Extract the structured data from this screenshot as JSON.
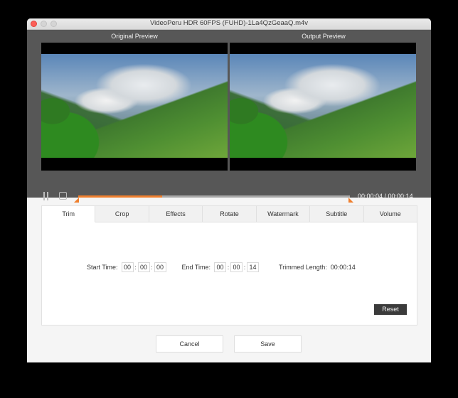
{
  "window": {
    "title": "VideoPeru  HDR 60FPS (FUHD)-1La4QzGeaaQ.m4v"
  },
  "preview": {
    "original_label": "Original Preview",
    "output_label": "Output  Preview"
  },
  "playback": {
    "progress_fraction": 0.31,
    "trim_start_fraction": 0.0,
    "trim_end_fraction": 1.0,
    "time_readout": "00:00:04 / 00:00:14",
    "accent_color": "#ef7f2e"
  },
  "tabs": [
    {
      "label": "Trim",
      "active": true
    },
    {
      "label": "Crop",
      "active": false
    },
    {
      "label": "Effects",
      "active": false
    },
    {
      "label": "Rotate",
      "active": false
    },
    {
      "label": "Watermark",
      "active": false
    },
    {
      "label": "Subtitle",
      "active": false
    },
    {
      "label": "Volume",
      "active": false
    }
  ],
  "trim": {
    "start_label": "Start Time:",
    "start": {
      "h": "00",
      "m": "00",
      "s": "00"
    },
    "end_label": "End Time:",
    "end": {
      "h": "00",
      "m": "00",
      "s": "14"
    },
    "length_label": "Trimmed Length:",
    "length_value": "00:00:14",
    "separator": ":",
    "reset_label": "Reset"
  },
  "footer": {
    "cancel_label": "Cancel",
    "save_label": "Save"
  }
}
